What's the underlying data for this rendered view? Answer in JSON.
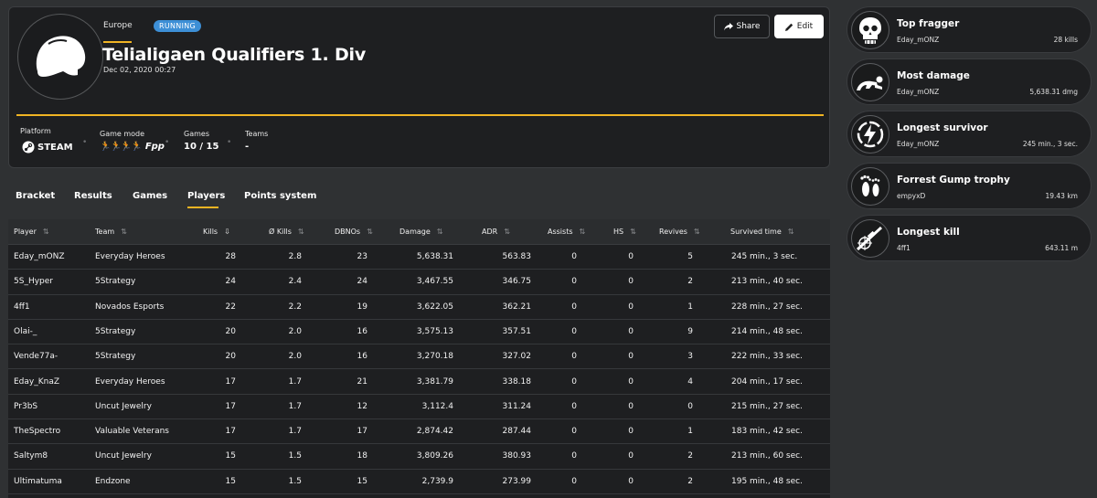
{
  "tournament": {
    "region": "Europe",
    "status": "RUNNING",
    "title": "Telialigaen Qualifiers 1. Div",
    "date": "Dec 02, 2020 00:27",
    "share_label": "Share",
    "edit_label": "Edit",
    "accent_color": "#f0b423",
    "meta": {
      "platform_label": "Platform",
      "platform_value": "STEAM",
      "game_mode_label": "Game mode",
      "game_mode_value": "Fpp",
      "games_label": "Games",
      "games_value": "10 / 15",
      "teams_label": "Teams",
      "teams_value": "-"
    }
  },
  "tabs": [
    {
      "label": "Bracket"
    },
    {
      "label": "Results"
    },
    {
      "label": "Games"
    },
    {
      "label": "Players",
      "active": true
    },
    {
      "label": "Points system"
    }
  ],
  "table": {
    "columns": [
      "Player",
      "Team",
      "Kills",
      "Ø Kills",
      "DBNOs",
      "Damage",
      "ADR",
      "Assists",
      "HS",
      "Revives",
      "Survived time"
    ],
    "rows": [
      [
        "Eday_mONZ",
        "Everyday Heroes",
        "28",
        "2.8",
        "23",
        "5,638.31",
        "563.83",
        "0",
        "0",
        "5",
        "245 min., 3 sec."
      ],
      [
        "5S_Hyper",
        "5Strategy",
        "24",
        "2.4",
        "24",
        "3,467.55",
        "346.75",
        "0",
        "0",
        "2",
        "213 min., 40 sec."
      ],
      [
        "4ff1",
        "Novados Esports",
        "22",
        "2.2",
        "19",
        "3,622.05",
        "362.21",
        "0",
        "0",
        "1",
        "228 min., 27 sec."
      ],
      [
        "Olai-_",
        "5Strategy",
        "20",
        "2.0",
        "16",
        "3,575.13",
        "357.51",
        "0",
        "0",
        "9",
        "214 min., 48 sec."
      ],
      [
        "Vende77a-",
        "5Strategy",
        "20",
        "2.0",
        "16",
        "3,270.18",
        "327.02",
        "0",
        "0",
        "3",
        "222 min., 33 sec."
      ],
      [
        "Eday_KnaZ",
        "Everyday Heroes",
        "17",
        "1.7",
        "21",
        "3,381.79",
        "338.18",
        "0",
        "0",
        "4",
        "204 min., 17 sec."
      ],
      [
        "Pr3bS",
        "Uncut Jewelry",
        "17",
        "1.7",
        "12",
        "3,112.4",
        "311.24",
        "0",
        "0",
        "0",
        "215 min., 27 sec."
      ],
      [
        "TheSpectro",
        "Valuable Veterans",
        "17",
        "1.7",
        "17",
        "2,874.42",
        "287.44",
        "0",
        "0",
        "1",
        "183 min., 42 sec."
      ],
      [
        "Saltym8",
        "Uncut Jewelry",
        "15",
        "1.5",
        "18",
        "3,809.26",
        "380.93",
        "0",
        "0",
        "2",
        "213 min., 60 sec."
      ],
      [
        "Ultimatuma",
        "Endzone",
        "15",
        "1.5",
        "15",
        "2,739.9",
        "273.99",
        "0",
        "0",
        "2",
        "195 min., 48 sec."
      ]
    ]
  },
  "awards": [
    {
      "title": "Top fragger",
      "player": "Eday_mONZ",
      "value": "28 kills",
      "icon": "skull-icon"
    },
    {
      "title": "Most damage",
      "player": "Eday_mONZ",
      "value": "5,638.31 dmg",
      "icon": "crawling-player-icon"
    },
    {
      "title": "Longest survivor",
      "player": "Eday_mONZ",
      "value": "245 min., 3 sec.",
      "icon": "lightning-circle-icon"
    },
    {
      "title": "Forrest Gump trophy",
      "player": "empyxD",
      "value": "19.43 km",
      "icon": "footprints-icon"
    },
    {
      "title": "Longest kill",
      "player": "4ff1",
      "value": "643.11 m",
      "icon": "sniper-rifle-icon"
    }
  ]
}
